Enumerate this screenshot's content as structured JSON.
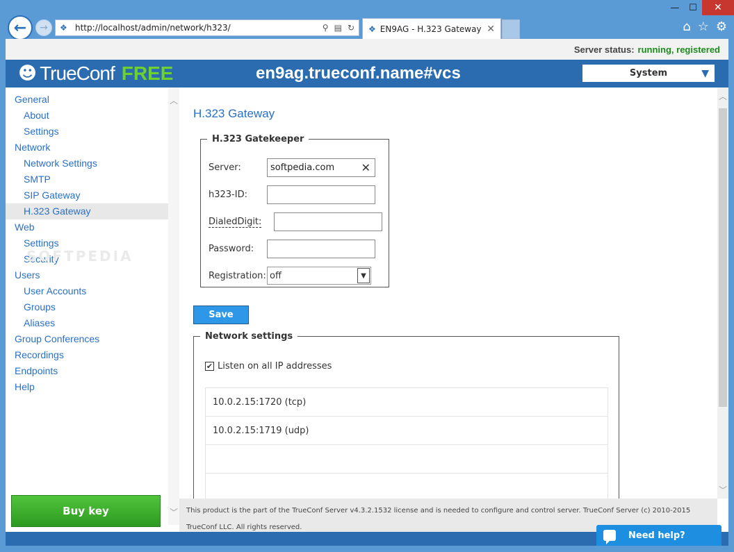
{
  "browser": {
    "url": "http://localhost/admin/network/h323/",
    "tab_title": "EN9AG - H.323 Gateway",
    "win_minimize": "—",
    "win_maximize": "☐",
    "win_close": "✕"
  },
  "status": {
    "label": "Server status:",
    "value": "running, registered"
  },
  "header": {
    "logo_text": "TrueConf",
    "logo_free": "FREE",
    "server_name": "en9ag.trueconf.name#vcs",
    "system_select": "System"
  },
  "sidebar": {
    "items": [
      {
        "label": "General",
        "sub": false
      },
      {
        "label": "About",
        "sub": true
      },
      {
        "label": "Settings",
        "sub": true
      },
      {
        "label": "Network",
        "sub": false
      },
      {
        "label": "Network Settings",
        "sub": true
      },
      {
        "label": "SMTP",
        "sub": true
      },
      {
        "label": "SIP Gateway",
        "sub": true
      },
      {
        "label": "H.323 Gateway",
        "sub": true,
        "active": true
      },
      {
        "label": "Web",
        "sub": false
      },
      {
        "label": "Settings",
        "sub": true
      },
      {
        "label": "Security",
        "sub": true
      },
      {
        "label": "Users",
        "sub": false
      },
      {
        "label": "User Accounts",
        "sub": true
      },
      {
        "label": "Groups",
        "sub": true
      },
      {
        "label": "Aliases",
        "sub": true
      },
      {
        "label": "Group Conferences",
        "sub": false
      },
      {
        "label": "Recordings",
        "sub": false
      },
      {
        "label": "Endpoints",
        "sub": false
      },
      {
        "label": "Help",
        "sub": false
      }
    ],
    "buy_key": "Buy key",
    "watermark": "SOFTPEDIA"
  },
  "main": {
    "title": "H.323 Gateway",
    "gatekeeper": {
      "legend": "H.323 Gatekeeper",
      "server_label": "Server:",
      "server_value": "softpedia.com",
      "h323id_label": "h323-ID:",
      "h323id_value": "",
      "dialed_label": "DialedDigit:",
      "dialed_value": "",
      "password_label": "Password:",
      "password_value": "",
      "registration_label": "Registration:",
      "registration_value": "off"
    },
    "save_label": "Save",
    "network": {
      "legend": "Network settings",
      "listen_label": "Listen on all IP addresses",
      "listen_checked": true,
      "addresses": [
        "10.0.2.15:1720 (tcp)",
        "10.0.2.15:1719 (udp)",
        "",
        ""
      ]
    }
  },
  "footer": {
    "text": "This product is the part of the TrueConf Server v4.3.2.1532 license and is needed to configure and control server. TrueConf Server (c) 2010-2015 TrueConf LLC. All rights reserved."
  },
  "help": {
    "label": "Need help?"
  }
}
